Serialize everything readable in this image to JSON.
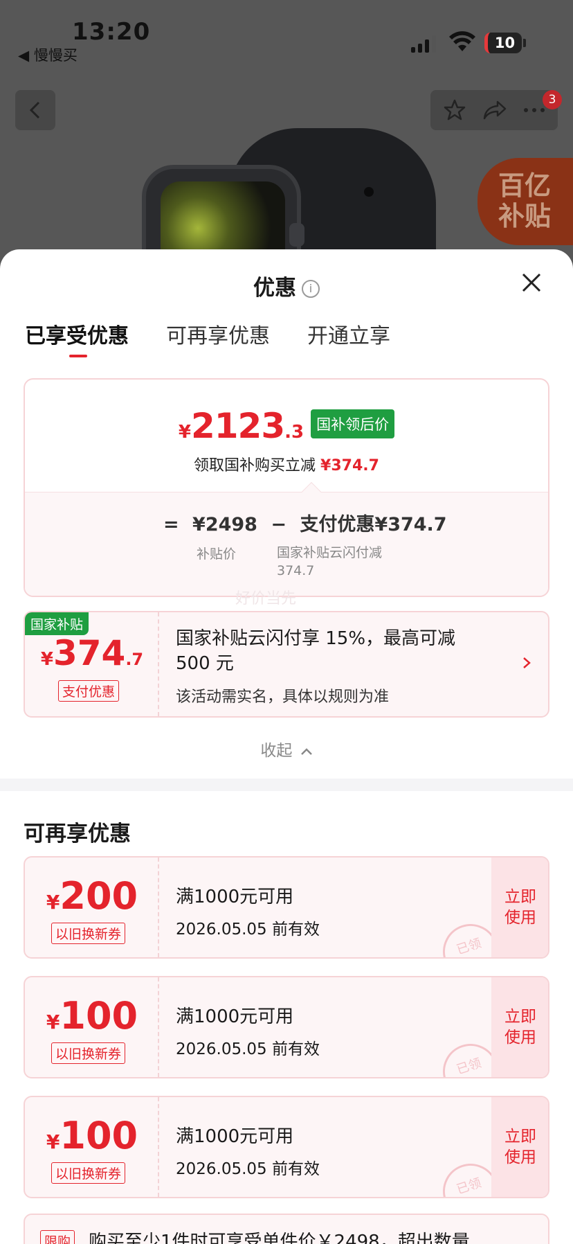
{
  "status_bar": {
    "time": "13:20",
    "back_app": "◀ 慢慢买",
    "battery": "10"
  },
  "nav": {
    "badge_count": "3"
  },
  "subsidy_logo": {
    "line1": "百亿",
    "line2": "补贴"
  },
  "sheet": {
    "title": "优惠",
    "info_symbol": "i"
  },
  "tabs": [
    {
      "label": "已享受优惠",
      "active": true
    },
    {
      "label": "可再享优惠",
      "active": false
    },
    {
      "label": "开通立享",
      "active": false
    }
  ],
  "price_card": {
    "currency": "¥",
    "price_int": "2123",
    "price_dec": ".3",
    "tag": "国补领后价",
    "sub_label": "领取国补购买立减",
    "sub_amount": "¥374.7",
    "eq": "=",
    "base_price": "¥2498",
    "minus": "−",
    "discount": "支付优惠¥374.7",
    "base_label": "补贴价",
    "discount_label": "国家补贴云闪付减374.7"
  },
  "watermark": "好价当先",
  "pay_card": {
    "tag": "国家补贴",
    "currency": "¥",
    "amount_int": "374",
    "amount_dec": ".7",
    "badge": "支付优惠",
    "title": "国家补贴云闪付享 15%，最高可减 500 元",
    "note": "该活动需实名，具体以规则为准"
  },
  "collapse_label": "收起",
  "section_title": "可再享优惠",
  "coupons": [
    {
      "currency": "¥",
      "amount": "200",
      "type": "以旧换新券",
      "condition": "满1000元可用",
      "expiry": "2026.05.05 前有效",
      "action": "立即使用",
      "stamp": "已领"
    },
    {
      "currency": "¥",
      "amount": "100",
      "type": "以旧换新券",
      "condition": "满1000元可用",
      "expiry": "2026.05.05 前有效",
      "action": "立即使用",
      "stamp": "已领"
    },
    {
      "currency": "¥",
      "amount": "100",
      "type": "以旧换新券",
      "condition": "满1000元可用",
      "expiry": "2026.05.05 前有效",
      "action": "立即使用",
      "stamp": "已领"
    }
  ],
  "limit": {
    "tag": "限购",
    "text": "购买至少1件时可享受单件价￥2498，超出数量"
  },
  "colors": {
    "accent_red": "#e4232c",
    "subsidy_green": "#1f9e41"
  }
}
